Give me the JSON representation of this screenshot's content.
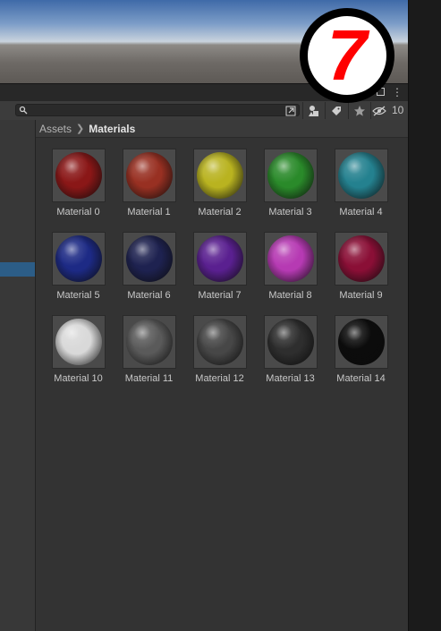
{
  "toolbar": {
    "search_placeholder": "",
    "hidden_count": "10"
  },
  "breadcrumb": {
    "root": "Assets",
    "current": "Materials"
  },
  "badge": {
    "number": "7"
  },
  "materials": [
    {
      "label": "Material 0",
      "color": "#8a1717"
    },
    {
      "label": "Material 1",
      "color": "#983022"
    },
    {
      "label": "Material 2",
      "color": "#b9b320"
    },
    {
      "label": "Material 3",
      "color": "#2a8a2a"
    },
    {
      "label": "Material 4",
      "color": "#24818f"
    },
    {
      "label": "Material 5",
      "color": "#1d2a85"
    },
    {
      "label": "Material 6",
      "color": "#1e2250"
    },
    {
      "label": "Material 7",
      "color": "#5a2090"
    },
    {
      "label": "Material 8",
      "color": "#b63ab3"
    },
    {
      "label": "Material 9",
      "color": "#8a0f36"
    },
    {
      "label": "Material 10",
      "color": "#d9d9d9"
    },
    {
      "label": "Material 11",
      "color": "#5a5a5a"
    },
    {
      "label": "Material 12",
      "color": "#474747"
    },
    {
      "label": "Material 13",
      "color": "#2e2e2e"
    },
    {
      "label": "Material 14",
      "color": "#0c0c0c"
    }
  ]
}
